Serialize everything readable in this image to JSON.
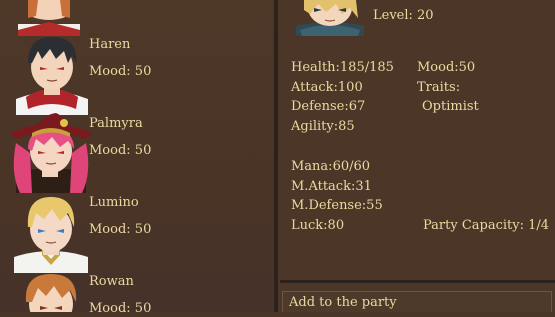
{
  "party_list": {
    "members": [
      {
        "name": "Haren",
        "mood": "Mood: 50"
      },
      {
        "name": "Palmyra",
        "mood": "Mood: 50"
      },
      {
        "name": "Lumino",
        "mood": "Mood: 50"
      },
      {
        "name": "Rowan",
        "mood": "Mood: 50"
      }
    ]
  },
  "detail": {
    "level": "Level: 20",
    "stats": {
      "health": "Health:185/185",
      "attack": "Attack:100",
      "defense": "Defense:67",
      "agility": "Agility:85",
      "mana": "Mana:60/60",
      "m_attack": "M.Attack:31",
      "m_defense": "M.Defense:55",
      "luck": "Luck:80",
      "mood": "Mood:50",
      "traits_label": "Traits:",
      "trait": "Optimist",
      "party_capacity": "Party Capacity: 1/4"
    },
    "add_button": "Add to the party"
  },
  "colors": {
    "panel": "#4b3627",
    "divider": "#2d221b",
    "text": "#ecd9a0"
  }
}
